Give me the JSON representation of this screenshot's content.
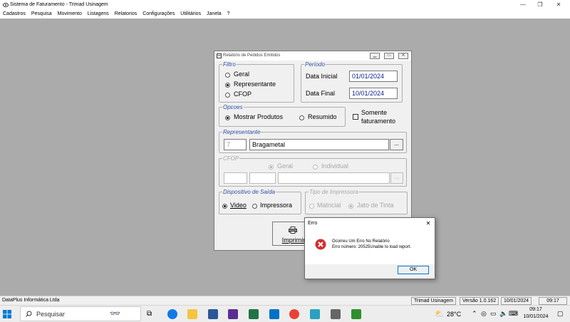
{
  "window": {
    "title": "Sistema de Faturamento - Trimad Usinagem",
    "minimize": "—",
    "maximize": "❐",
    "close": "✕"
  },
  "menu": [
    "Cadastros",
    "Pesquisa",
    "Movimento",
    "Listagens",
    "Relatorios",
    "Configurações",
    "Utilitários",
    "Janela",
    "?"
  ],
  "report_dialog": {
    "title": "Relatório de Pedidos Emitidos",
    "filtro": {
      "legend": "Filtro",
      "options": [
        "Geral",
        "Representante",
        "CFOP"
      ],
      "selected": "Representante"
    },
    "periodo": {
      "legend": "Período",
      "start_label": "Data Inicial",
      "start_value": "01/01/2024",
      "end_label": "Data Final",
      "end_value": "10/01/2024"
    },
    "opcoes": {
      "legend": "Opcoes",
      "options": [
        "Mostrar Produtos",
        "Resumido"
      ],
      "selected": "Mostrar Produtos",
      "somente_line1": "Somente",
      "somente_line2": "faturamento",
      "somente_checked": false
    },
    "representante": {
      "legend": "Representante",
      "code": "7",
      "name": "Bragametal",
      "browse": "..."
    },
    "cfop": {
      "legend": "CFOP",
      "options": [
        "Geral",
        "Individual"
      ],
      "selected": "Geral",
      "browse": "..."
    },
    "dispositivo": {
      "legend": "Dispositivo de Saída",
      "options": [
        "Video",
        "Impressora"
      ],
      "selected": "Video"
    },
    "impressora": {
      "legend": "Tipo de Impressora",
      "options": [
        "Matricial",
        "Jato de Tinta"
      ],
      "selected": "Jato de Tinta"
    },
    "print_button": "Imprimir"
  },
  "error_dialog": {
    "title": "Erro",
    "close": "✕",
    "line1": "Ocorreu Um Erro No Relatório",
    "line2": "Erro número: 20525Unable to load report.",
    "ok": "OK"
  },
  "statusbar": {
    "company": "DataPlus Informática Ltda",
    "client": "Trimad Usinagem",
    "version": "Versão 1.0.162",
    "date": "10/01/2024",
    "time": "09:17"
  },
  "taskbar": {
    "search_placeholder": "Pesquisar",
    "temperature": "28°C",
    "clock_time": "09:17",
    "clock_date": "10/01/2024",
    "colors": {
      "edge": "#0f7ae5",
      "explorer": "#f4c542",
      "word": "#2b579a",
      "store": "#5c2d91",
      "excel": "#217346",
      "outlook": "#0072c6",
      "chrome": "#e94235"
    }
  }
}
